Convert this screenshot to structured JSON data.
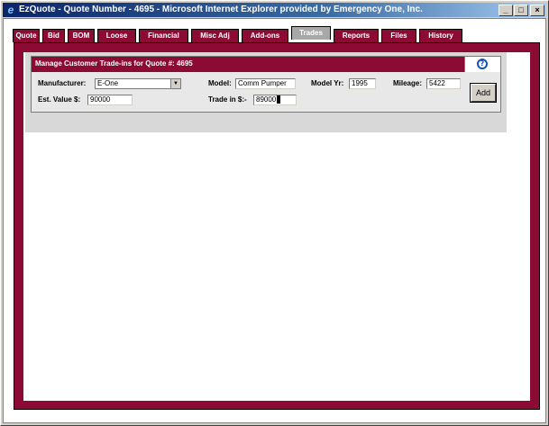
{
  "window": {
    "title": "EzQuote - Quote Number - 4695 - Microsoft Internet Explorer provided by Emergency One, Inc.",
    "icon": "ie-icon",
    "controls": {
      "minimize": "_",
      "maximize": "□",
      "close": "×"
    }
  },
  "tabs": [
    {
      "label": "Quote"
    },
    {
      "label": "Bid"
    },
    {
      "label": "BOM"
    },
    {
      "label": "Loose"
    },
    {
      "label": "Financial"
    },
    {
      "label": "Misc Adj"
    },
    {
      "label": "Add-ons"
    },
    {
      "label": "Trades",
      "active": true
    },
    {
      "label": "Reports"
    },
    {
      "label": "Files"
    },
    {
      "label": "History"
    }
  ],
  "panel": {
    "header": "Manage Customer Trade-ins for Quote #: 4695",
    "help_icon": "?"
  },
  "form": {
    "manufacturer_label": "Manufacturer:",
    "manufacturer_value": "E-One",
    "model_label": "Model:",
    "model_value": "Comm Pumper",
    "model_yr_label": "Model Yr:",
    "model_yr_value": "1995",
    "mileage_label": "Mileage:",
    "mileage_value": "5422",
    "est_value_label": "Est. Value $:",
    "est_value_value": "90000",
    "trade_in_label": "Trade in $:-",
    "trade_in_value": "89000",
    "add_button": "Add"
  },
  "colors": {
    "brand": "#8b0b35",
    "active_tab": "#a8a8a8"
  }
}
